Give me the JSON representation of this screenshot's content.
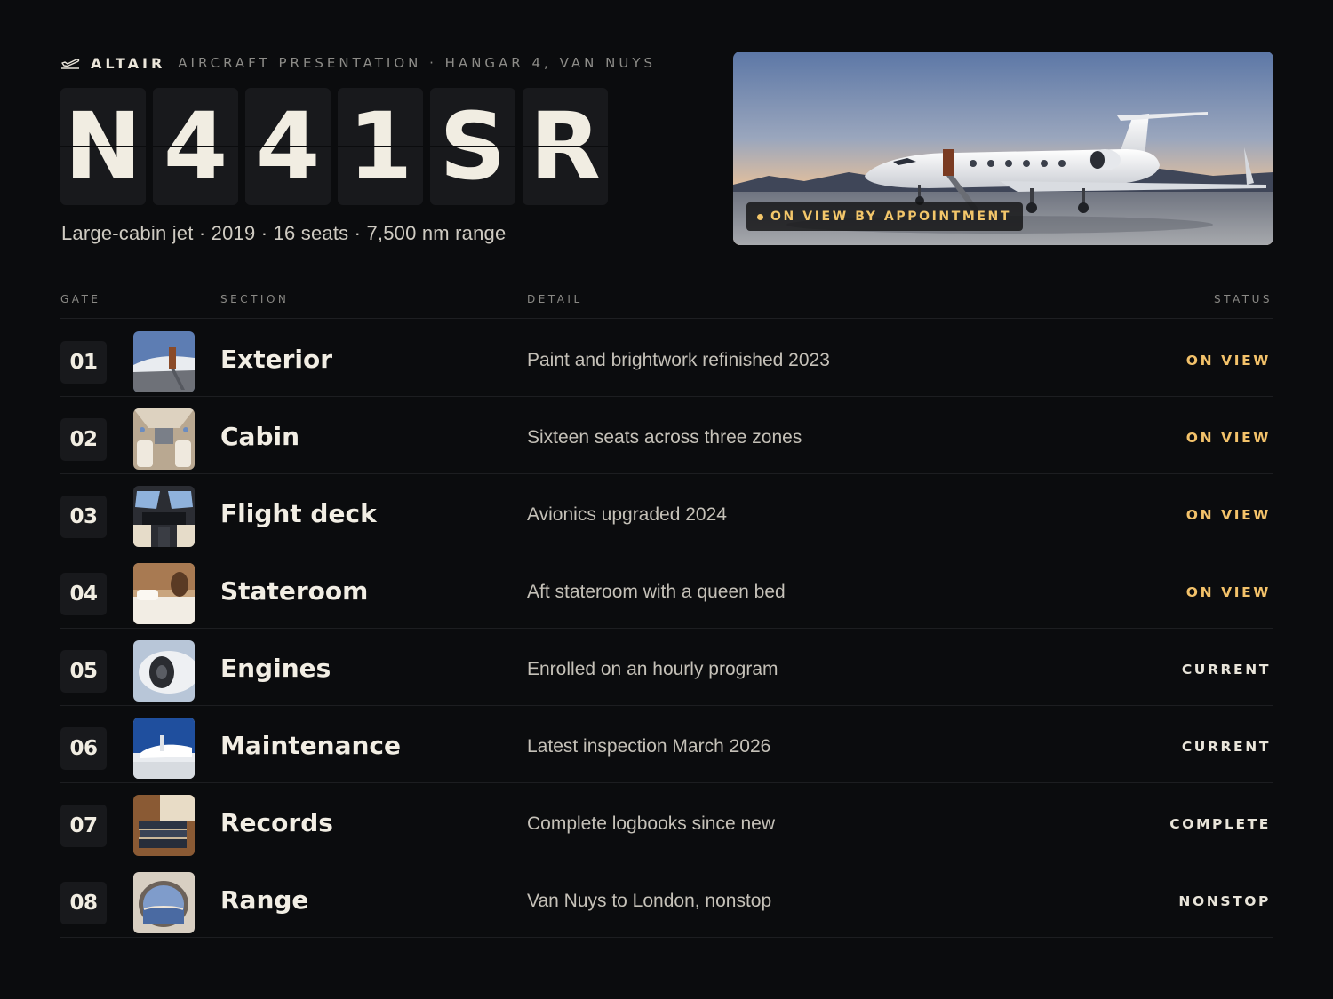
{
  "brand": {
    "name": "ALTAIR",
    "subtitle": "AIRCRAFT PRESENTATION · HANGAR 4, VAN NUYS",
    "icon": "plane-takeoff-icon"
  },
  "tail_number": [
    "N",
    "4",
    "4",
    "1",
    "S",
    "R"
  ],
  "summary": "Large-cabin jet · 2019 · 16 seats · 7,500 nm range",
  "hero": {
    "badge": "ON VIEW BY APPOINTMENT"
  },
  "table": {
    "headers": {
      "gate": "GATE",
      "section": "SECTION",
      "detail": "DETAIL",
      "status": "STATUS"
    },
    "rows": [
      {
        "gate": "01",
        "section": "Exterior",
        "detail": "Paint and brightwork refinished 2023",
        "status": "ON VIEW"
      },
      {
        "gate": "02",
        "section": "Cabin",
        "detail": "Sixteen seats across three zones",
        "status": "ON VIEW"
      },
      {
        "gate": "03",
        "section": "Flight deck",
        "detail": "Avionics upgraded 2024",
        "status": "ON VIEW"
      },
      {
        "gate": "04",
        "section": "Stateroom",
        "detail": "Aft stateroom with a queen bed",
        "status": "ON VIEW"
      },
      {
        "gate": "05",
        "section": "Engines",
        "detail": "Enrolled on an hourly program",
        "status": "CURRENT"
      },
      {
        "gate": "06",
        "section": "Maintenance",
        "detail": "Latest inspection March 2026",
        "status": "CURRENT"
      },
      {
        "gate": "07",
        "section": "Records",
        "detail": "Complete logbooks since new",
        "status": "COMPLETE"
      },
      {
        "gate": "08",
        "section": "Range",
        "detail": "Van Nuys to London, nonstop",
        "status": "NONSTOP"
      }
    ]
  },
  "colors": {
    "background": "#0b0c0e",
    "accent": "#f3c26a",
    "tile": "#18191c"
  }
}
